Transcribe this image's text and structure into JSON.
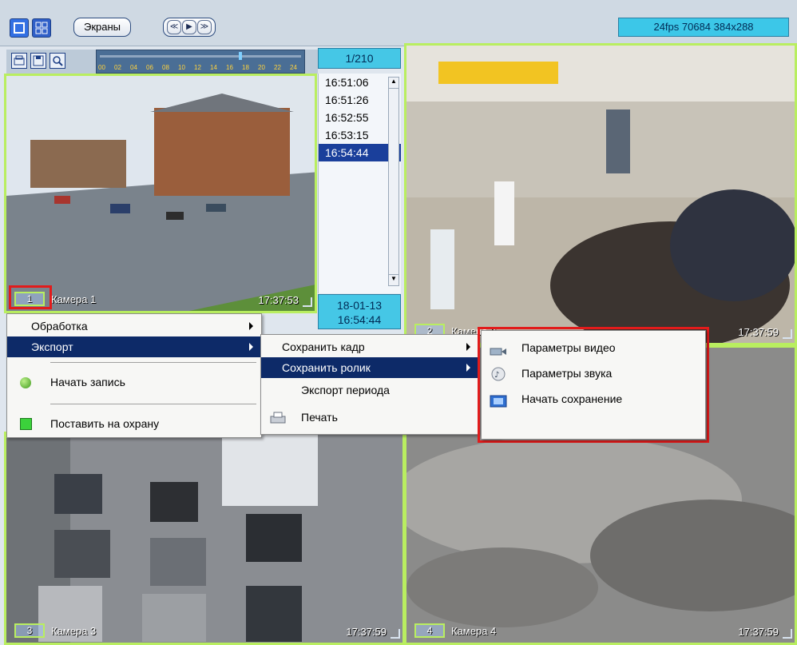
{
  "toolbar": {
    "screens_label": "Экраны",
    "nav_prev_glyph": "≪",
    "nav_play_glyph": "▶",
    "nav_next_glyph": "≫",
    "fps_info": "24fps 70684 384x288"
  },
  "timeline": {
    "ticks": [
      "00",
      "02",
      "04",
      "06",
      "08",
      "10",
      "12",
      "14",
      "16",
      "18",
      "20",
      "22",
      "24"
    ]
  },
  "archive": {
    "page_counter": "1/210",
    "times": [
      "16:51:06",
      "16:51:26",
      "16:52:55",
      "16:53:15",
      "16:54:44"
    ],
    "selected_index": 4,
    "date_line1": "18-01-13",
    "date_line2": "16:54:44"
  },
  "cameras": [
    {
      "num": "1",
      "name": "Камера 1",
      "time": "17:37:53"
    },
    {
      "num": "2",
      "name": "Камера 2",
      "time": "17:37:59"
    },
    {
      "num": "3",
      "name": "Камера 3",
      "time": "17:37:59"
    },
    {
      "num": "4",
      "name": "Камера 4",
      "time": "17:37:59"
    }
  ],
  "context_menu": {
    "processing": "Обработка",
    "export": "Экспорт",
    "start_recording": "Начать запись",
    "arm": "Поставить на охрану"
  },
  "export_menu": {
    "save_frame": "Сохранить кадр",
    "save_clip": "Сохранить ролик",
    "export_period": "Экспорт периода",
    "print": "Печать"
  },
  "clip_menu": {
    "video_params": "Параметры видео",
    "audio_params": "Параметры звука",
    "start_saving": "Начать сохранение"
  },
  "colors": {
    "tile_border": "#b9ee60",
    "highlight": "#0d2a68",
    "red_frame": "#e21b1b",
    "info_cyan": "#3cc7e8"
  }
}
